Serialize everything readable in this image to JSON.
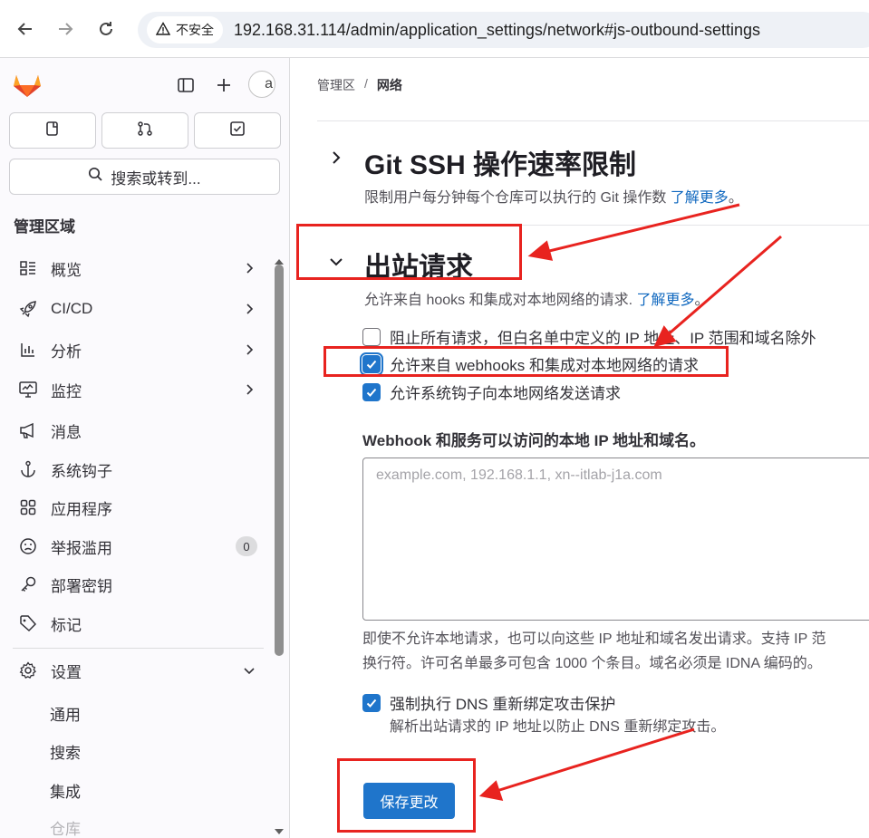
{
  "browser": {
    "security_label": "不安全",
    "url": "192.168.31.114/admin/application_settings/network#js-outbound-settings"
  },
  "sidebar": {
    "avatar_alt": "a",
    "search_label": "搜索或转到...",
    "section_title": "管理区域",
    "items": [
      {
        "label": "概览",
        "icon": "overview-icon"
      },
      {
        "label": "CI/CD",
        "icon": "rocket-icon"
      },
      {
        "label": "分析",
        "icon": "chart-icon"
      },
      {
        "label": "监控",
        "icon": "monitor-icon"
      },
      {
        "label": "消息",
        "icon": "megaphone-icon"
      },
      {
        "label": "系统钩子",
        "icon": "anchor-icon"
      },
      {
        "label": "应用程序",
        "icon": "apps-icon"
      },
      {
        "label": "举报滥用",
        "icon": "abuse-icon",
        "badge": "0"
      },
      {
        "label": "部署密钥",
        "icon": "key-icon"
      },
      {
        "label": "标记",
        "icon": "label-icon"
      }
    ],
    "settings_label": "设置",
    "sub_items": [
      "通用",
      "搜索",
      "集成",
      "仓库"
    ]
  },
  "breadcrumb": {
    "parent": "管理区",
    "separator": "/",
    "current": "网络"
  },
  "git_ssh": {
    "title": "Git SSH 操作速率限制",
    "description": "限制用户每分钟每个仓库可以执行的 Git 操作数",
    "learn_more": "了解更多",
    "suffix": "。"
  },
  "outbound": {
    "title": "出站请求",
    "description": "允许来自 hooks 和集成对本地网络的请求.",
    "learn_more": "了解更多",
    "suffix": "。",
    "checkboxes": [
      {
        "label": "阻止所有请求，但白名单中定义的 IP 地址、IP 范围和域名除外",
        "checked": false
      },
      {
        "label": "允许来自 webhooks 和集成对本地网络的请求",
        "checked": true
      },
      {
        "label": "允许系统钩子向本地网络发送请求",
        "checked": true
      }
    ],
    "allowlist_label": "Webhook 和服务可以访问的本地 IP 地址和域名。",
    "allowlist_placeholder": "example.com, 192.168.1.1, xn--itlab-j1a.com",
    "help_line1": "即使不允许本地请求，也可以向这些 IP 地址和域名发出请求。支持 IP 范",
    "help_line2": "换行符。许可名单最多可包含 1000 个条目。域名必须是 IDNA 编码的。",
    "dns_checkbox": {
      "label": "强制执行 DNS 重新绑定攻击保护",
      "checked": true
    },
    "dns_help": "解析出站请求的 IP 地址以防止 DNS 重新绑定攻击。",
    "save_label": "保存更改"
  },
  "colors": {
    "accent": "#1f75cb",
    "link": "#1068bf",
    "annotation": "#e8231f"
  }
}
